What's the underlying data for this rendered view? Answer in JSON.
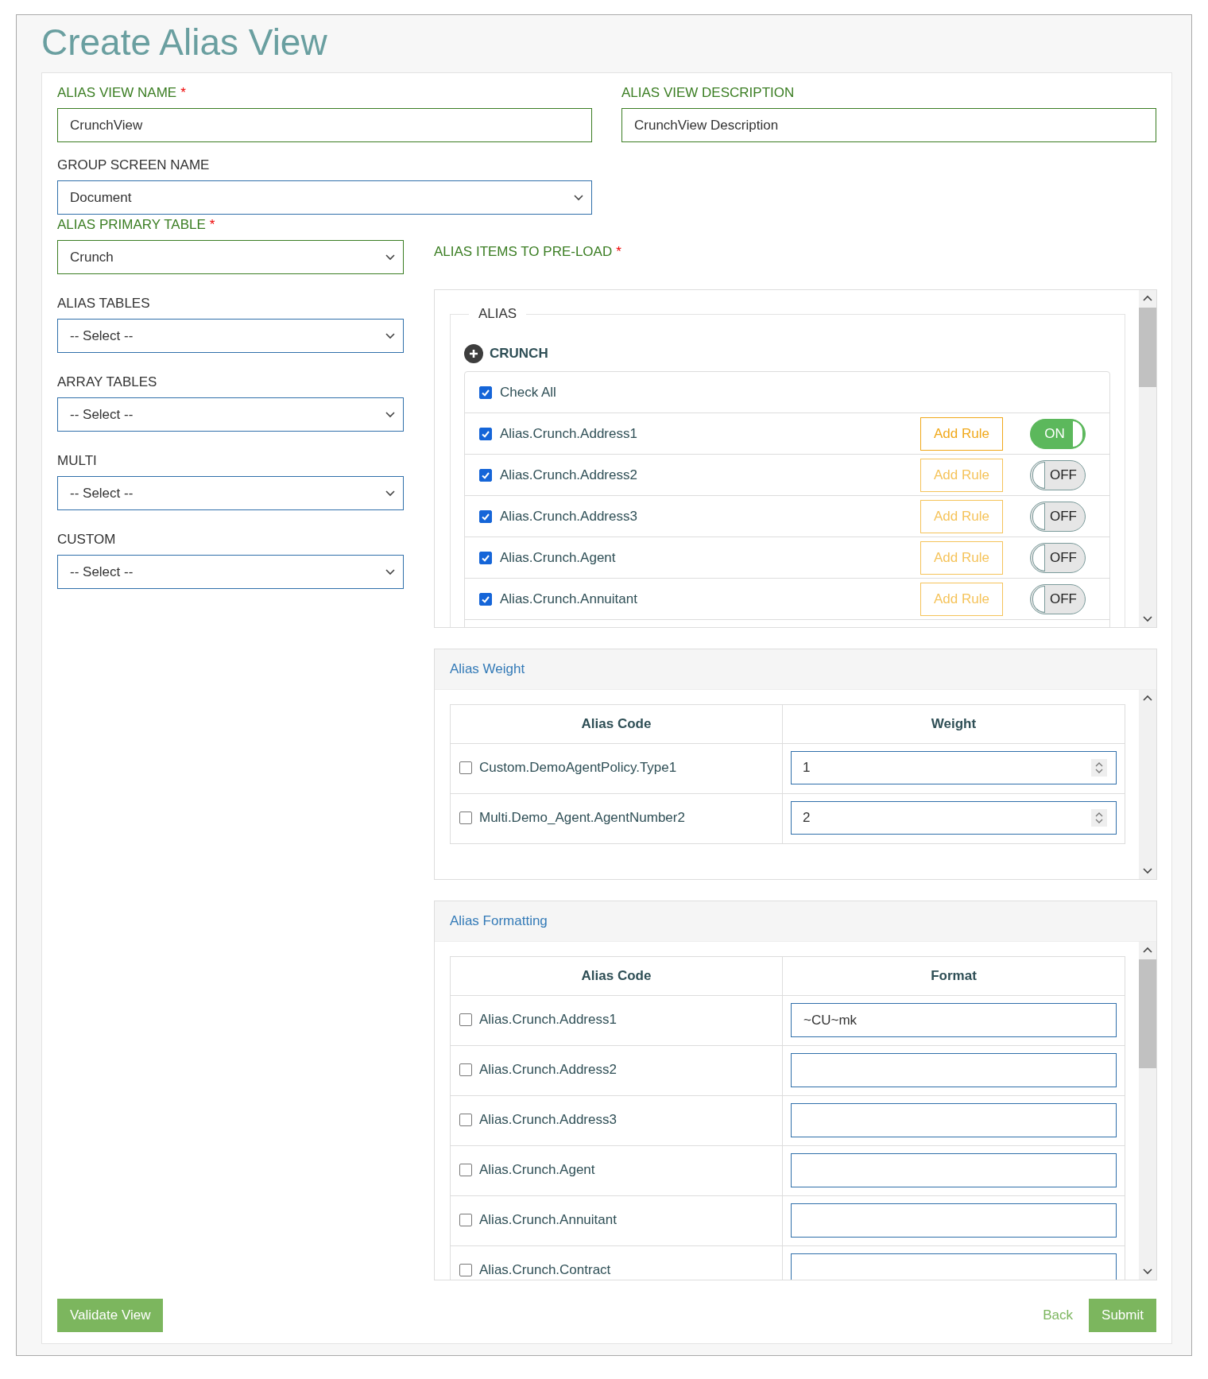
{
  "title": "Create Alias View",
  "top_fields": [
    {
      "label": "ALIAS VIEW NAME",
      "marker": "*",
      "valid": true,
      "kind": "text",
      "value": "CrunchView"
    },
    {
      "label": "ALIAS VIEW DESCRIPTION",
      "valid": true,
      "kind": "text",
      "value": "CrunchView Description"
    },
    {
      "label": "GROUP SCREEN NAME",
      "valid": false,
      "kind": "select",
      "value": "Document"
    }
  ],
  "left_fields": [
    {
      "label": "ALIAS PRIMARY TABLE",
      "marker": "*",
      "valid": true,
      "value": "Crunch"
    },
    {
      "label": "ALIAS TABLES",
      "valid": false,
      "value": "-- Select --"
    },
    {
      "label": "ARRAY TABLES",
      "valid": false,
      "value": "-- Select --"
    },
    {
      "label": "MULTI",
      "valid": false,
      "value": "-- Select --"
    },
    {
      "label": "CUSTOM",
      "valid": false,
      "value": "-- Select --"
    }
  ],
  "alias_items": {
    "label": "ALIAS ITEMS TO PRE-LOAD",
    "marker": "*",
    "valid": true,
    "legend": "ALIAS",
    "group": "CRUNCH",
    "check_all": {
      "label": "Check All",
      "checked": true
    },
    "items": [
      {
        "name": "Alias.Crunch.Address1",
        "checked": true,
        "rule_button": "Add Rule",
        "rule_enabled": true,
        "toggle": "ON",
        "on": true
      },
      {
        "name": "Alias.Crunch.Address2",
        "checked": true,
        "rule_button": "Add Rule",
        "rule_enabled": false,
        "toggle": "OFF",
        "on": false
      },
      {
        "name": "Alias.Crunch.Address3",
        "checked": true,
        "rule_button": "Add Rule",
        "rule_enabled": false,
        "toggle": "OFF",
        "on": false
      },
      {
        "name": "Alias.Crunch.Agent",
        "checked": true,
        "rule_button": "Add Rule",
        "rule_enabled": false,
        "toggle": "OFF",
        "on": false
      },
      {
        "name": "Alias.Crunch.Annuitant",
        "checked": true,
        "rule_button": "Add Rule",
        "rule_enabled": false,
        "toggle": "OFF",
        "on": false
      }
    ]
  },
  "alias_weight": {
    "title": "Alias Weight",
    "columns": [
      "Alias Code",
      "Weight"
    ],
    "rows": [
      {
        "code": "Custom.DemoAgentPolicy.Type1",
        "checked": false,
        "value": "1"
      },
      {
        "code": "Multi.Demo_Agent.AgentNumber2",
        "checked": false,
        "value": "2"
      }
    ]
  },
  "alias_formatting": {
    "title": "Alias Formatting",
    "columns": [
      "Alias Code",
      "Format"
    ],
    "rows": [
      {
        "code": "Alias.Crunch.Address1",
        "checked": false,
        "value": "~CU~mk"
      },
      {
        "code": "Alias.Crunch.Address2",
        "checked": false
      },
      {
        "code": "Alias.Crunch.Address3",
        "checked": false
      },
      {
        "code": "Alias.Crunch.Agent",
        "checked": false
      },
      {
        "code": "Alias.Crunch.Annuitant",
        "checked": false
      },
      {
        "code": "Alias.Crunch.Contract",
        "checked": false
      }
    ]
  },
  "buttons": {
    "validate": "Validate View",
    "back": "Back",
    "submit": "Submit"
  }
}
